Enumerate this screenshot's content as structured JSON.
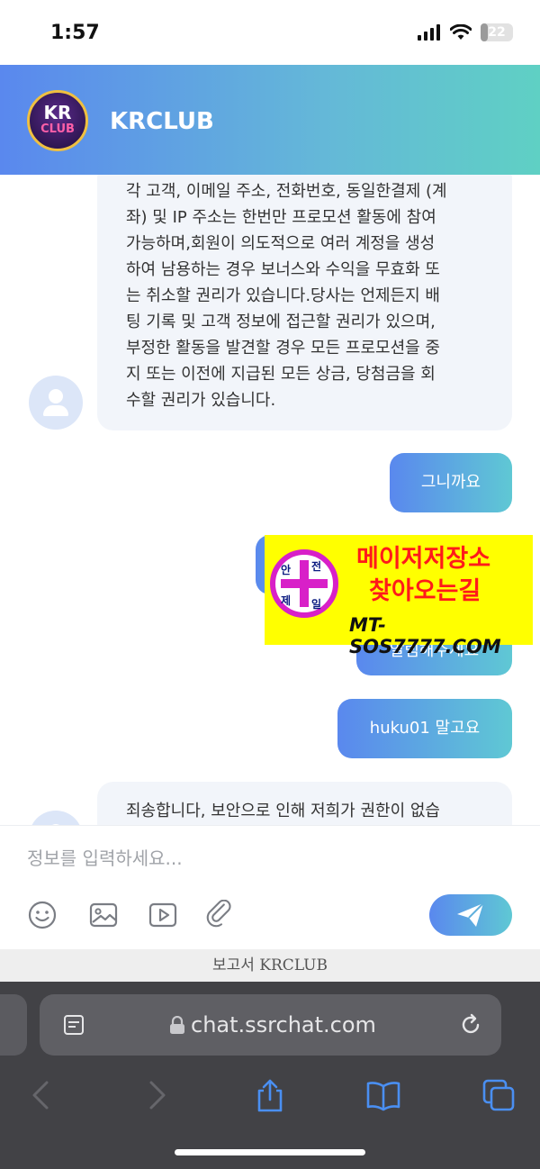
{
  "status_bar": {
    "time": "1:57",
    "battery": "22",
    "battery_level": 0.22
  },
  "header": {
    "title": "KRCLUB",
    "logo_top": "KR",
    "logo_bottom": "CLUB"
  },
  "messages": [
    {
      "side": "in",
      "lines": [
        "각 고객, 이메일 주소, 전화번호, 동일한결제 (계",
        "좌) 및 IP 주소는 한번만 프로모션 활동에 참여",
        "가능하며,회원이 의도적으로 여러 계정을 생성",
        "하여 남용하는 경우 보너스와 수익을 무효화 또",
        "는 취소할 권리가 있습니다.당사는 언제든지 배",
        "팅 기록 및 고객 정보에 접근할 권리가 있으며,",
        "부정한 활동을 발견할 경우 모든 프로모션을 중",
        "지 또는 이전에 지급된 모든 상금, 당첨금을 회",
        "수할 권리가 있습니다."
      ]
    },
    {
      "side": "out",
      "text": "그니까요"
    },
    {
      "side": "out",
      "text": "알림해주세요"
    },
    {
      "side": "out",
      "text": "huku01 말고요"
    },
    {
      "side": "in",
      "lines": [
        "죄송합니다, 보안으로 인해 저희가 권한이 없습"
      ]
    }
  ],
  "ad": {
    "line1": "메이저저장소",
    "line2": "찾아오는길",
    "url": "MT-SOS7777.COM",
    "badge": [
      "안",
      "전",
      "제",
      "일"
    ]
  },
  "composer": {
    "placeholder": "정보를 입력하세요...",
    "tools": [
      "emoji-icon",
      "image-icon",
      "video-icon",
      "attachment-icon"
    ],
    "send_icon": "send-icon"
  },
  "footer": {
    "text": "보고서 KRCLUB"
  },
  "browser": {
    "url": "chat.ssrchat.com"
  },
  "colors": {
    "accent_start": "#5a88ee",
    "accent_end": "#5fc8d4",
    "bubble_in": "#f2f5fa",
    "ad_bg": "#ffff00",
    "ad_text": "#ff1a1a"
  }
}
